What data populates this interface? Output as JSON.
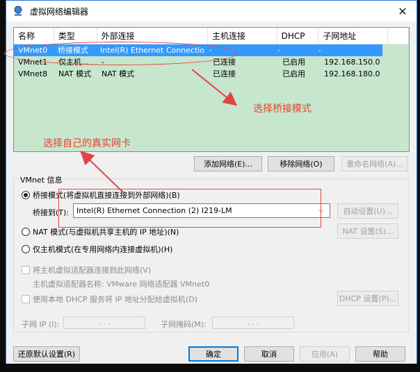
{
  "window": {
    "title": "虚拟网络编辑器",
    "close": "✕"
  },
  "network_list": {
    "columns": [
      "名称",
      "类型",
      "外部连接",
      "主机连接",
      "DHCP",
      "子网地址"
    ],
    "rows": [
      {
        "name": "VMnet0",
        "type": "桥接模式",
        "external": "Intel(R) Ethernet Connection...",
        "host": "-",
        "dhcp": "-",
        "subnet": "-",
        "selected": true
      },
      {
        "name": "VMnet1",
        "type": "仅主机...",
        "external": "-",
        "host": "已连接",
        "dhcp": "已启用",
        "subnet": "192.168.150.0",
        "selected": false
      },
      {
        "name": "VMnet8",
        "type": "NAT 模式",
        "external": "NAT 模式",
        "host": "已连接",
        "dhcp": "已启用",
        "subnet": "192.168.180.0",
        "selected": false
      }
    ]
  },
  "list_buttons": {
    "add": "添加网络(E)...",
    "remove": "移除网络(O)",
    "rename": "重命名网络(A)..."
  },
  "vmnet_info": {
    "group_title": "VMnet 信息",
    "bridged_label": "桥接模式(将虚拟机直接连接到外部网络)(B)",
    "bridged_to_label": "桥接到(T):",
    "bridged_to_value": "Intel(R) Ethernet Connection (2) I219-LM",
    "auto_settings": "自动设置(U)...",
    "nat_label": "NAT 模式(与虚拟机共享主机的 IP 地址)(N)",
    "nat_settings": "NAT 设置(S)...",
    "hostonly_label": "仅主机模式(在专用网络内连接虚拟机)(H)",
    "connect_adapter": "将主机虚拟适配器连接到此网络(V)",
    "adapter_name": "主机虚拟适配器名称: VMware 网络适配器 VMnet0",
    "use_dhcp": "使用本地 DHCP 服务将 IP 地址分配给虚拟机(D)",
    "dhcp_settings": "DHCP 设置(P)...",
    "subnet_ip_label": "子网 IP (I):",
    "subnet_ip_value": ". . .",
    "subnet_mask_label": "子网掩码(M):",
    "subnet_mask_value": ". . ."
  },
  "footer": {
    "restore": "还原默认设置(R)",
    "ok": "确定",
    "cancel": "取消",
    "apply": "应用(A)",
    "help": "帮助"
  },
  "annotations": {
    "select_bridge": "选择桥接模式",
    "select_nic": "选择自己的真实网卡",
    "color": "#e04545"
  }
}
